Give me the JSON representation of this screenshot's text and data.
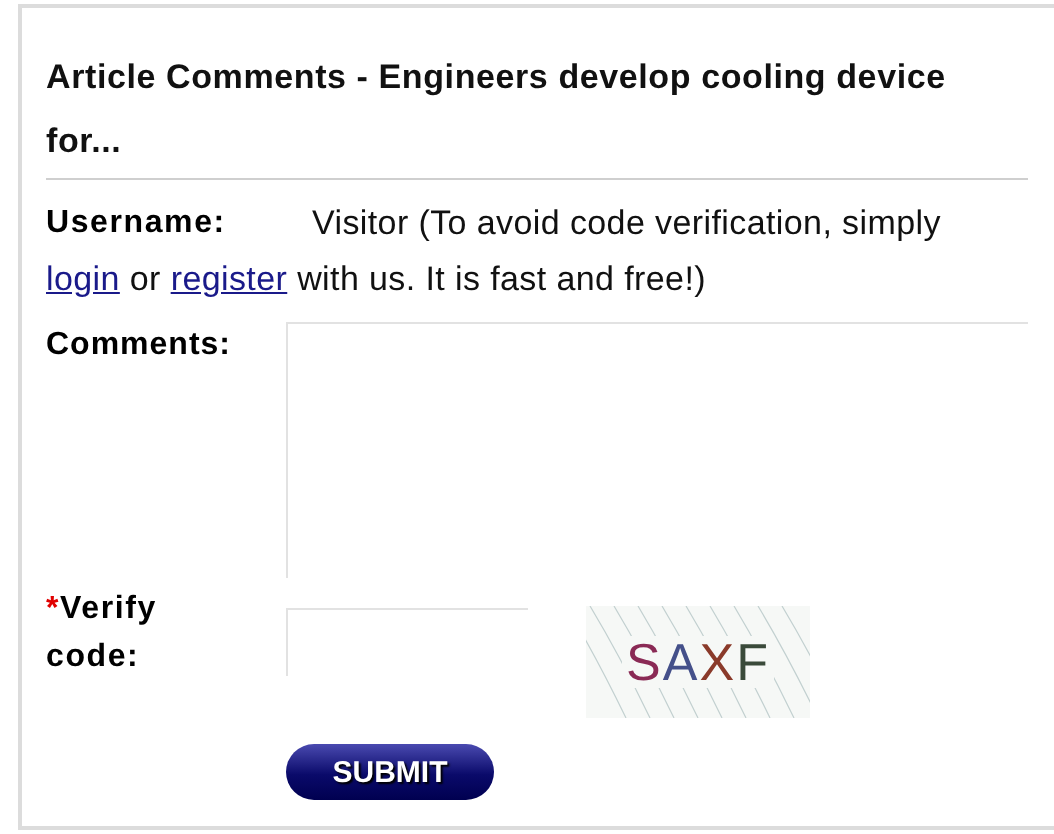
{
  "title": "Article Comments - Engineers develop cooling device for...",
  "username": {
    "label": "Username:",
    "value": "Visitor (To avoid code verification, simply",
    "login_link": "login",
    "or_text": "or",
    "register_link": "register",
    "rest": "with us. It is fast and free!)"
  },
  "comments": {
    "label": "Comments:"
  },
  "verify": {
    "required_mark": "*",
    "label": "Verify code:",
    "captcha": [
      {
        "char": "S",
        "color": "#8a2a55"
      },
      {
        "char": "A",
        "color": "#44508a"
      },
      {
        "char": "X",
        "color": "#8a3a2a"
      },
      {
        "char": "F",
        "color": "#3a4a3a"
      }
    ]
  },
  "submit": {
    "label": "SUBMIT"
  }
}
